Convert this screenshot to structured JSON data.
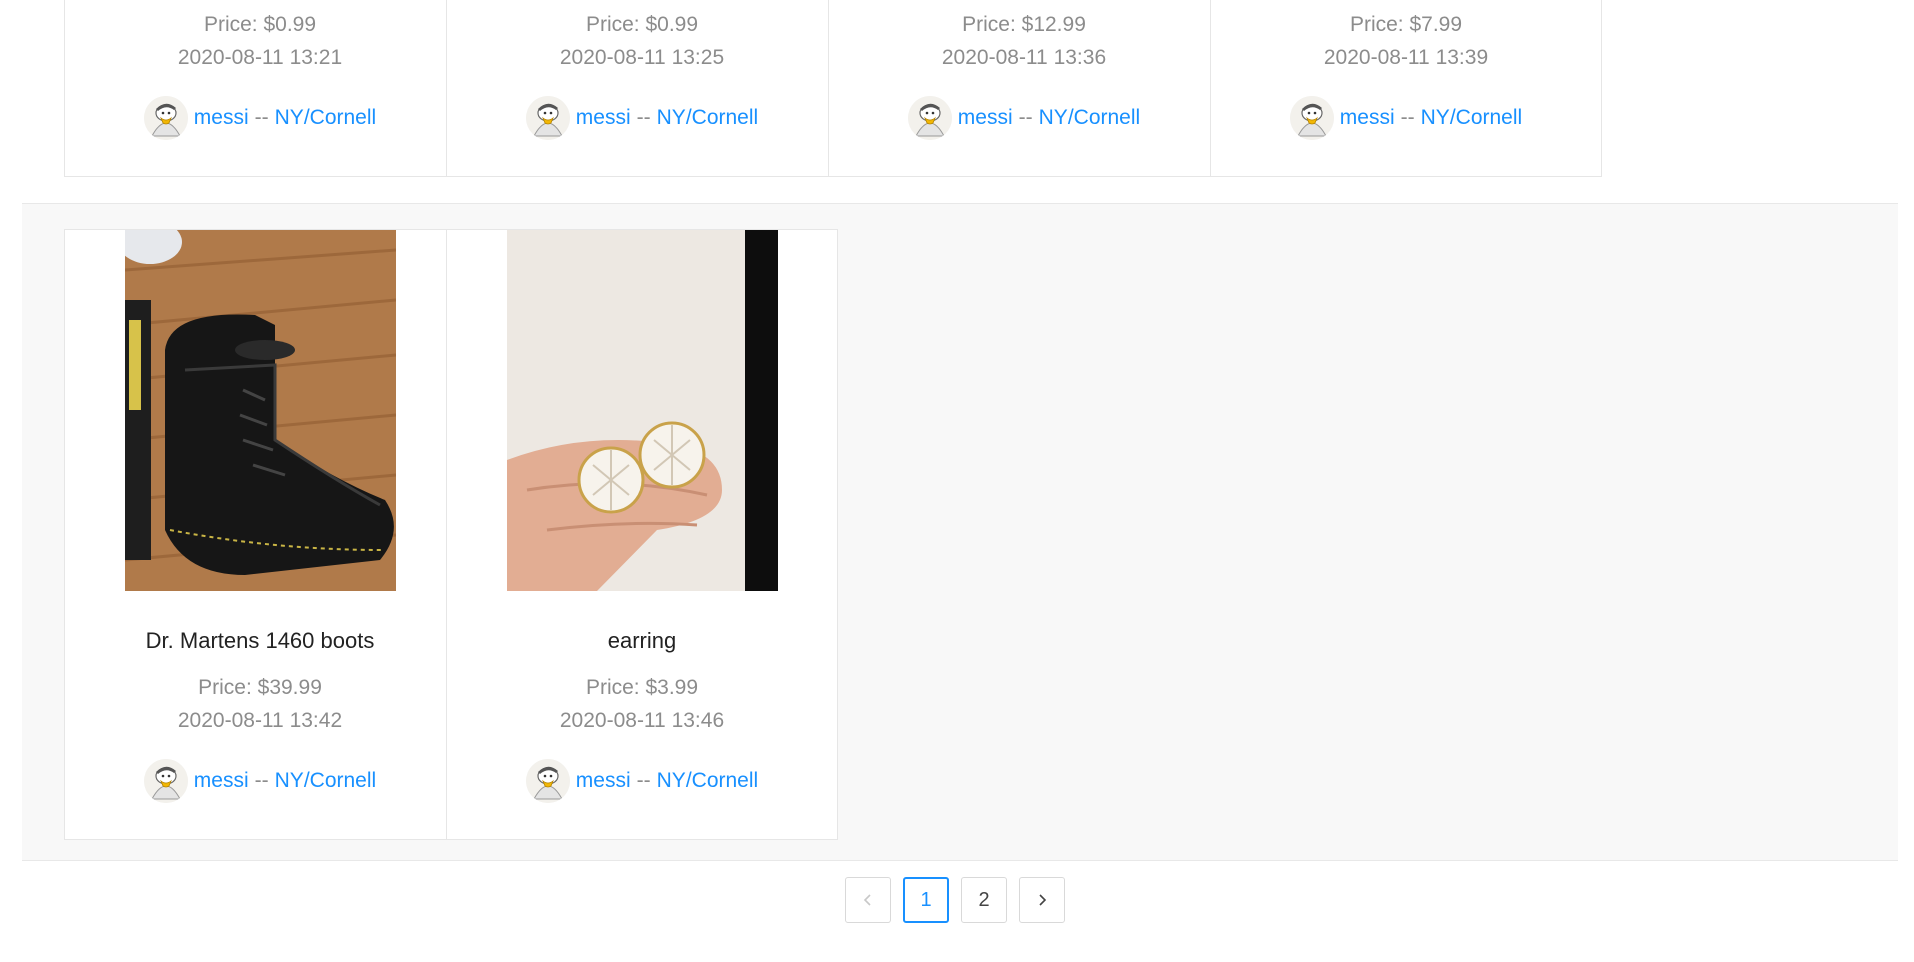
{
  "top_row": [
    {
      "price": "Price: $0.99",
      "date": "2020-08-11 13:21",
      "seller_name": "messi",
      "separator": "--",
      "location": "NY/Cornell"
    },
    {
      "price": "Price: $0.99",
      "date": "2020-08-11 13:25",
      "seller_name": "messi",
      "separator": "--",
      "location": "NY/Cornell"
    },
    {
      "price": "Price: $12.99",
      "date": "2020-08-11 13:36",
      "seller_name": "messi",
      "separator": "--",
      "location": "NY/Cornell"
    },
    {
      "price": "Price: $7.99",
      "date": "2020-08-11 13:39",
      "seller_name": "messi",
      "separator": "--",
      "location": "NY/Cornell"
    }
  ],
  "bottom_row": [
    {
      "title": "Dr. Martens 1460 boots",
      "price": "Price: $39.99",
      "date": "2020-08-11 13:42",
      "seller_name": "messi",
      "separator": "--",
      "location": "NY/Cornell",
      "image": "boots-photo"
    },
    {
      "title": "earring",
      "price": "Price: $3.99",
      "date": "2020-08-11 13:46",
      "seller_name": "messi",
      "separator": "--",
      "location": "NY/Cornell",
      "image": "earring-photo"
    }
  ],
  "pagination": {
    "prev_icon": "chevron-left-icon",
    "pages": [
      "1",
      "2"
    ],
    "current": "1",
    "next_icon": "chevron-right-icon"
  },
  "colors": {
    "link": "#1890ff",
    "muted": "#8c8c8c",
    "active_border": "#1890ff",
    "row_band": "#f8f8f8"
  }
}
